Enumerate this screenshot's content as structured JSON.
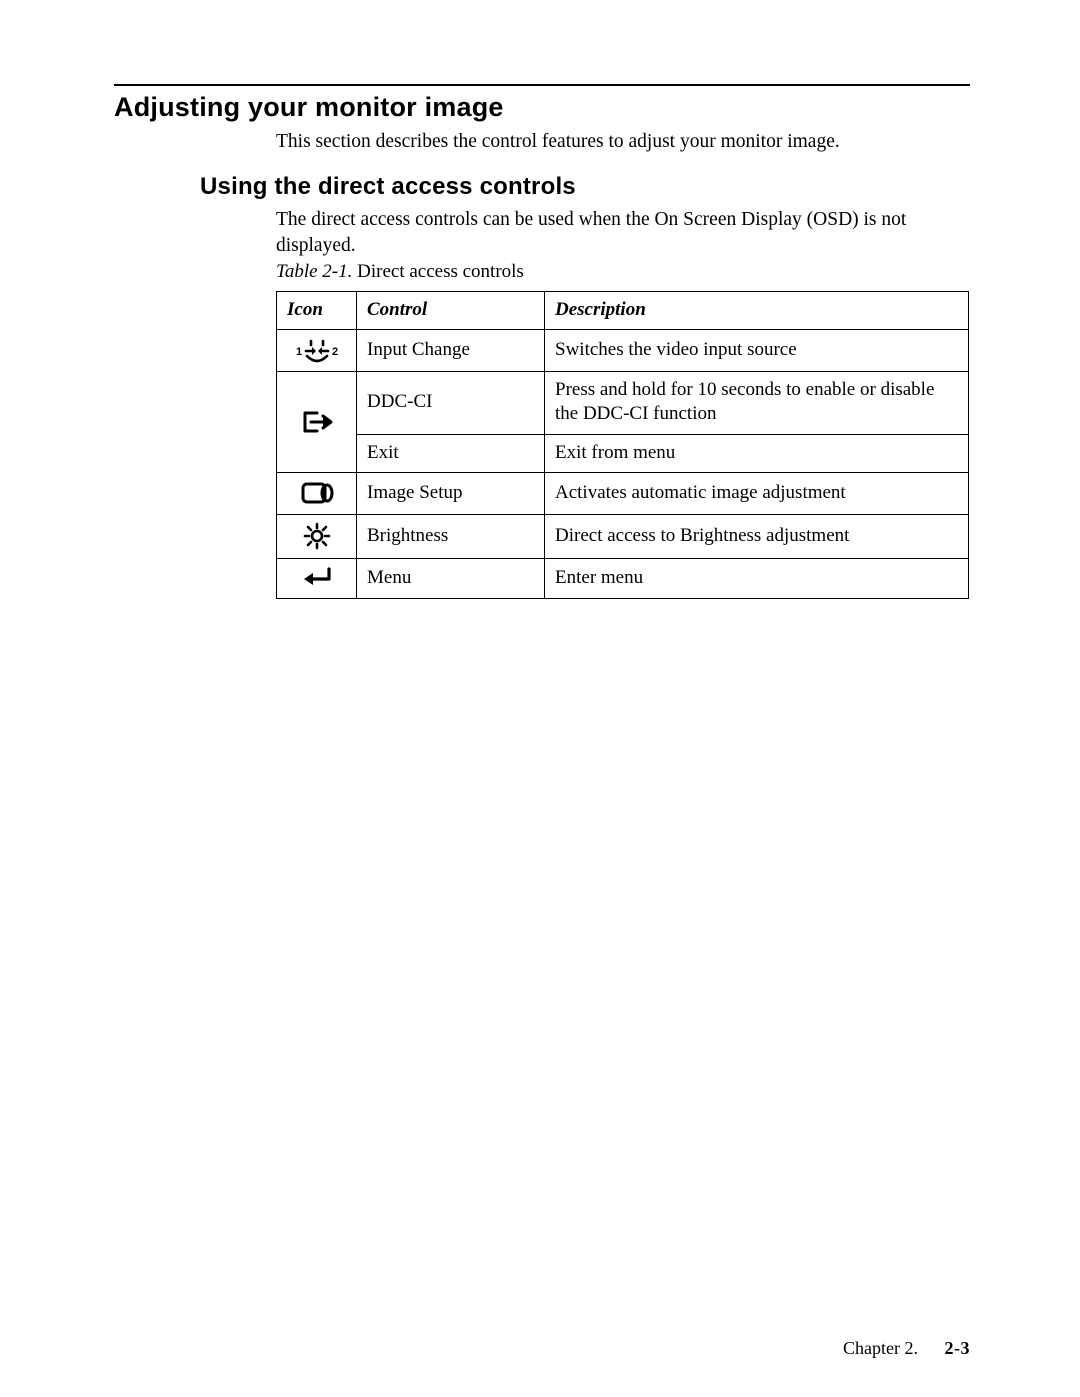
{
  "section_title": "Adjusting your monitor image",
  "section_intro": "This section describes the control features to adjust your monitor image.",
  "subsection_title": "Using the direct access controls",
  "subsection_intro": "The direct access controls can be used when the On Screen Display (OSD) is not displayed.",
  "table_caption_label": "Table 2-1.",
  "table_caption_text": "Direct access controls",
  "table": {
    "headers": {
      "icon": "Icon",
      "control": "Control",
      "description": "Description"
    },
    "rows": [
      {
        "icon_label": "input-change-icon",
        "control": "Input Change",
        "description": "Switches the video input source"
      },
      {
        "icon_label": "exit-arrow-icon",
        "control": "DDC-CI",
        "description": "Press and hold for 10 seconds to enable or disable the DDC-CI function"
      },
      {
        "icon_label": "",
        "control": "Exit",
        "description": "Exit from menu"
      },
      {
        "icon_label": "image-setup-icon",
        "control": "Image Setup",
        "description": "Activates automatic image adjustment"
      },
      {
        "icon_label": "brightness-icon",
        "control": "Brightness",
        "description": "Direct access to Brightness adjustment"
      },
      {
        "icon_label": "menu-enter-icon",
        "control": "Menu",
        "description": "Enter menu"
      }
    ]
  },
  "footer": {
    "chapter": "Chapter 2.",
    "page": "2-3"
  }
}
